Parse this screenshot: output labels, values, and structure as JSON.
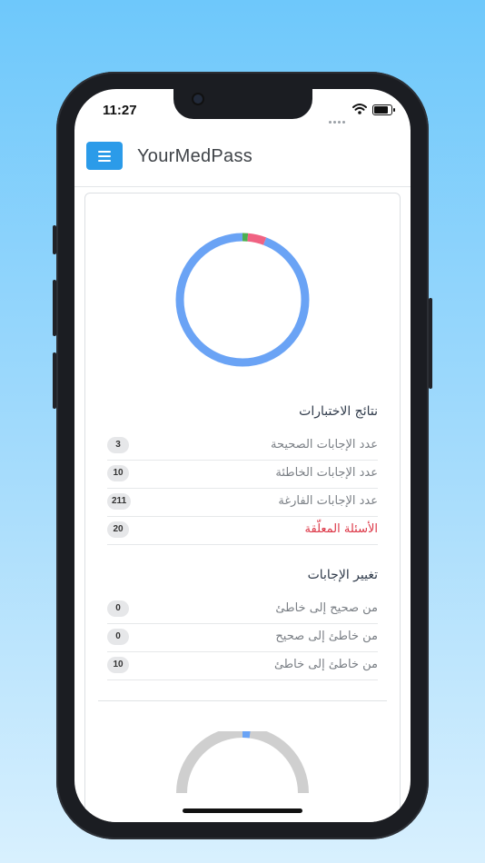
{
  "status_bar": {
    "time": "11:27"
  },
  "header": {
    "title": "YourMedPass"
  },
  "colors": {
    "accent": "#2b9be9",
    "donut_main": "#6aa3f5",
    "correct": "#4caf50",
    "wrong": "#f06282",
    "pending_red": "#dc3545",
    "gauge_bg": "#cfcfcf"
  },
  "results": {
    "title": "نتائج الاختبارات",
    "rows": [
      {
        "label": "عدد الإجابات الصحيحة",
        "value": "3"
      },
      {
        "label": "عدد الإجابات الخاطئة",
        "value": "10"
      },
      {
        "label": "عدد الإجابات الفارغة",
        "value": "211"
      },
      {
        "label": "الأسئلة المعلّقة",
        "value": "20"
      }
    ]
  },
  "changes": {
    "title": "تغيير الإجابات",
    "rows": [
      {
        "label": "من صحيح إلى خاطئ",
        "value": "0"
      },
      {
        "label": "من خاطئ إلى صحيح",
        "value": "0"
      },
      {
        "label": "من خاطئ إلى خاطئ",
        "value": "10"
      }
    ]
  },
  "chart_data": [
    {
      "type": "pie",
      "style": "donut",
      "slices": [
        {
          "name": "correct",
          "value": 3,
          "color": "#4caf50"
        },
        {
          "name": "wrong",
          "value": 10,
          "color": "#f06282"
        },
        {
          "name": "empty",
          "value": 211,
          "color": "#6aa3f5"
        }
      ]
    },
    {
      "type": "pie",
      "style": "half-gauge",
      "slices": [
        {
          "name": "changed",
          "value": 0.04,
          "color": "#6aa3f5"
        },
        {
          "name": "rest",
          "value": 0.96,
          "color": "#cfcfcf"
        }
      ]
    }
  ]
}
